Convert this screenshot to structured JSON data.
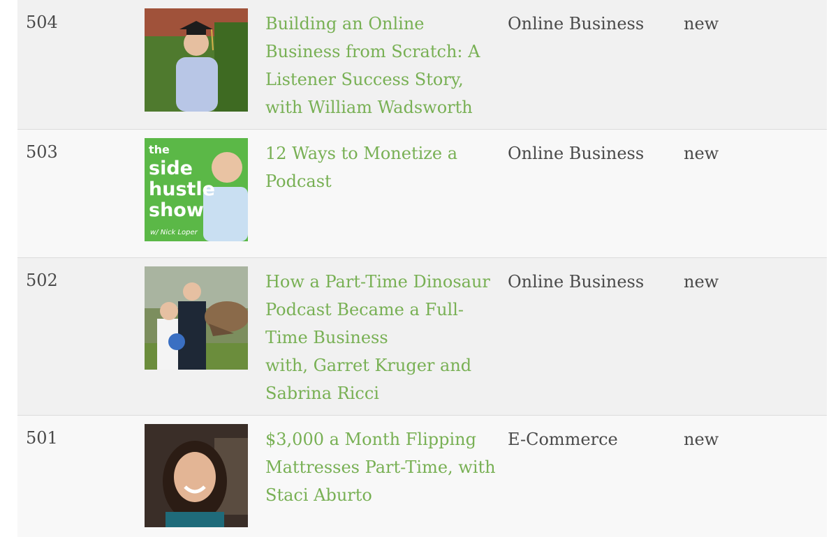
{
  "episodes": [
    {
      "number": "504",
      "title": "Building an Online\nBusiness from Scratch: A\nListener Success Story,\nwith William Wadsworth",
      "category": "Online Business",
      "status": "new",
      "thumbnail_icon": "graduate-photo-icon"
    },
    {
      "number": "503",
      "title": "12 Ways to Monetize a\nPodcast",
      "category": "Online Business",
      "status": "new",
      "thumbnail_icon": "side-hustle-show-logo-icon",
      "logo_text": {
        "line1": "the",
        "line2": "side",
        "line3": "hustle",
        "line4": "show",
        "line5": "w/ Nick Loper"
      }
    },
    {
      "number": "502",
      "title": "How a Part-Time Dinosaur\nPodcast Became a Full-\nTime Business\nwith, Garret Kruger and\nSabrina Ricci",
      "category": "Online Business",
      "status": "new",
      "thumbnail_icon": "wedding-dinosaur-photo-icon"
    },
    {
      "number": "501",
      "title": "$3,000 a Month Flipping\nMattresses Part-Time, with\nStaci Aburto",
      "category": "E-Commerce",
      "status": "new",
      "thumbnail_icon": "guest-portrait-icon"
    }
  ],
  "colors": {
    "link": "#78b054",
    "text": "#4a4a4a",
    "row_shade": "#f1f1f1",
    "row_light": "#f8f8f8",
    "logo_green": "#5bb847"
  }
}
